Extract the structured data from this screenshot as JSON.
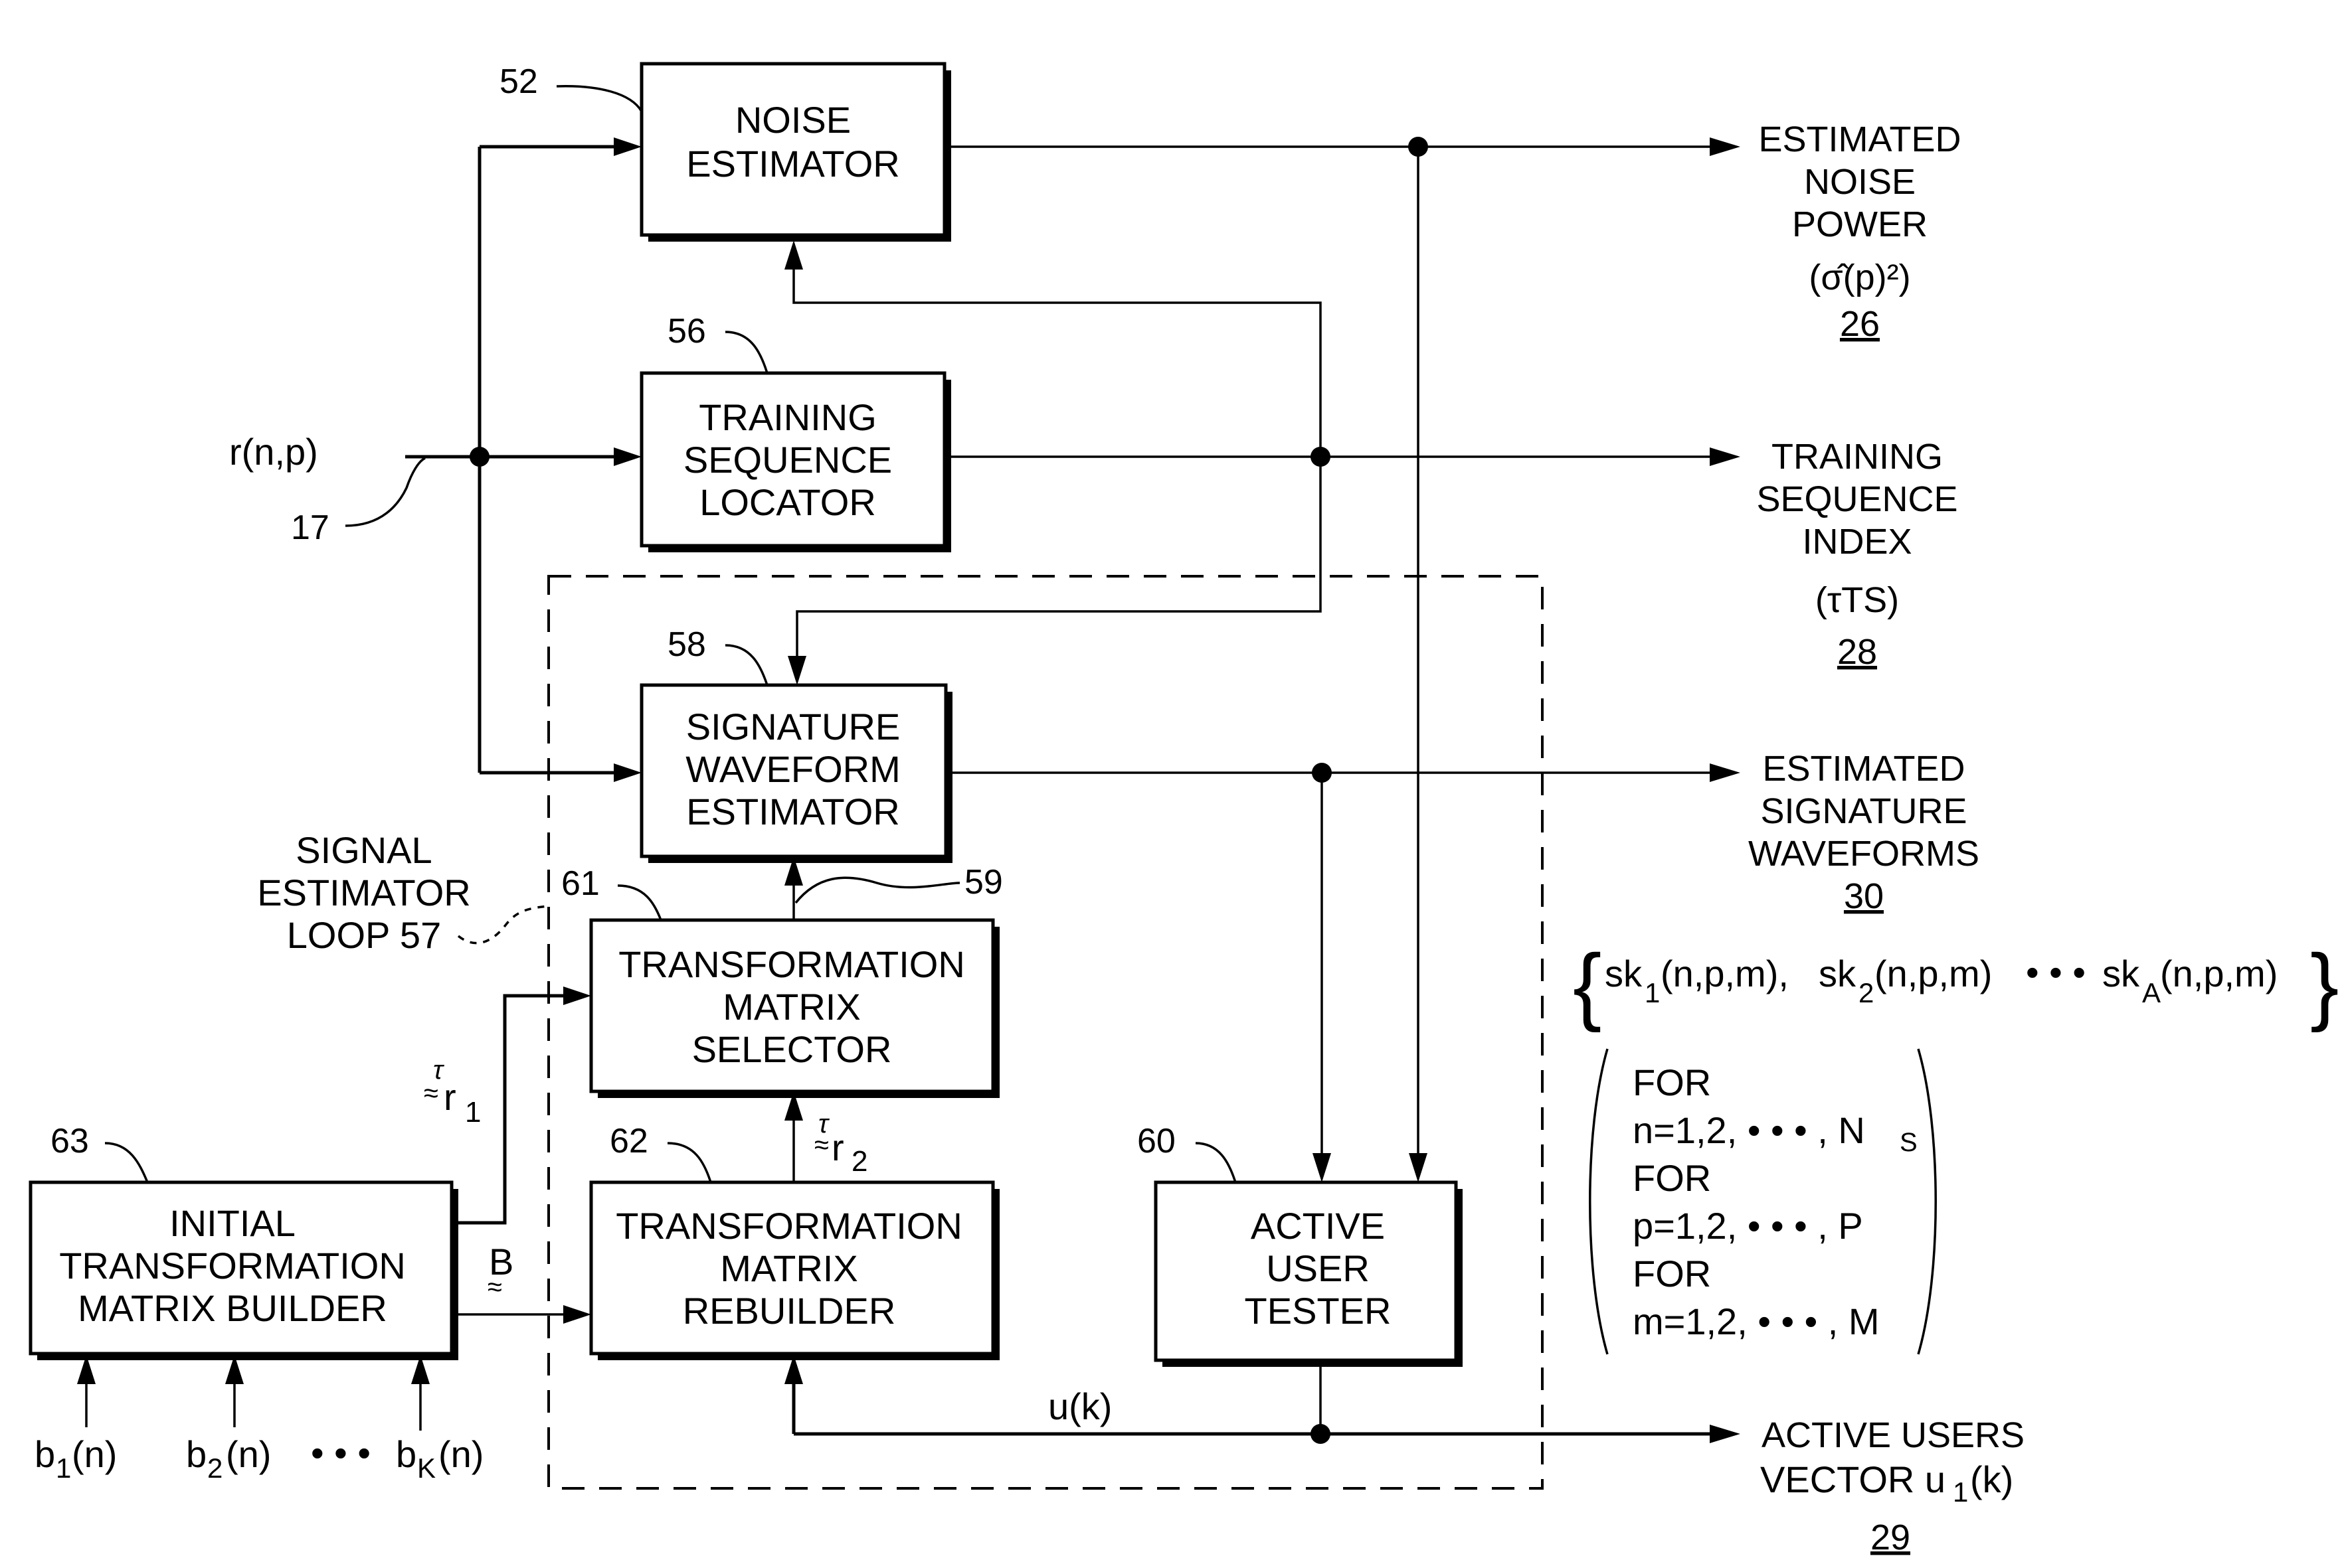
{
  "diagram": {
    "blocks": {
      "noise_estimator": {
        "ref": "52",
        "lines": [
          "NOISE",
          "ESTIMATOR"
        ]
      },
      "training_sequence_locator": {
        "ref": "56",
        "lines": [
          "TRAINING",
          "SEQUENCE",
          "LOCATOR"
        ]
      },
      "signature_waveform_estimator": {
        "ref": "58",
        "lines": [
          "SIGNATURE",
          "WAVEFORM",
          "ESTIMATOR"
        ]
      },
      "transformation_matrix_selector": {
        "ref": "61",
        "lines": [
          "TRANSFORMATION",
          "MATRIX",
          "SELECTOR"
        ]
      },
      "transformation_matrix_rebuilder": {
        "ref": "62",
        "lines": [
          "TRANSFORMATION",
          "MATRIX",
          "REBUILDER"
        ]
      },
      "active_user_tester": {
        "ref": "60",
        "lines": [
          "ACTIVE",
          "USER",
          "TESTER"
        ]
      },
      "initial_transformation_matrix_builder": {
        "ref": "63",
        "lines": [
          "INITIAL",
          "TRANSFORMATION",
          "MATRIX BUILDER"
        ]
      }
    },
    "input": {
      "signal": "r(n,p)",
      "ref": "17"
    },
    "loop": {
      "lines": [
        "SIGNAL",
        "ESTIMATOR",
        "LOOP 57"
      ]
    },
    "connection_ref_59": "59",
    "signals": {
      "tau_r1": {
        "symbol": "τ",
        "base": "r",
        "sub": "1"
      },
      "tau_r2": {
        "symbol": "τ",
        "base": "r",
        "sub": "2"
      },
      "B": "B",
      "u_k": "u(k)",
      "tilde": "≈"
    },
    "bit_inputs": [
      {
        "base": "b",
        "sub": "1",
        "arg": "(n)"
      },
      {
        "base": "b",
        "sub": "2",
        "arg": "(n)"
      },
      {
        "base": "b",
        "sub": "K",
        "arg": "(n)"
      }
    ],
    "bit_ellipsis": "• • •",
    "outputs": {
      "noise_power": {
        "lines": [
          "ESTIMATED",
          "NOISE",
          "POWER"
        ],
        "formula": "(σ̂(p)²)",
        "ref": "26"
      },
      "training_index": {
        "lines": [
          "TRAINING",
          "SEQUENCE",
          "INDEX"
        ],
        "formula": "(τTS)",
        "formula_symbol": "τ",
        "formula_sub": "TS",
        "ref": "28"
      },
      "signature_waveforms": {
        "lines": [
          "ESTIMATED",
          "SIGNATURE",
          "WAVEFORMS"
        ],
        "ref": "30"
      },
      "active_users": {
        "lines": [
          "ACTIVE USERS",
          "VECTOR u₁(k)"
        ],
        "line1": "ACTIVE USERS",
        "line2_prefix": "VECTOR u",
        "line2_sub": "1",
        "line2_suffix": "(k)",
        "ref": "29"
      }
    },
    "set_expression": {
      "terms": [
        {
          "base": "sk",
          "sub": "1",
          "args": "(n,p,m),"
        },
        {
          "base": "sk",
          "sub": "2",
          "args": "(n,p,m)"
        },
        {
          "base": "sk",
          "sub": "A",
          "args": "(n,p,m)"
        }
      ],
      "ellipsis": "• • •",
      "conditions": [
        "FOR",
        "n=1,2, • • • , N",
        "FOR",
        "p=1,2, • • • , P",
        "FOR",
        "m=1,2, • • • , M"
      ],
      "ns_sub": "S"
    }
  }
}
